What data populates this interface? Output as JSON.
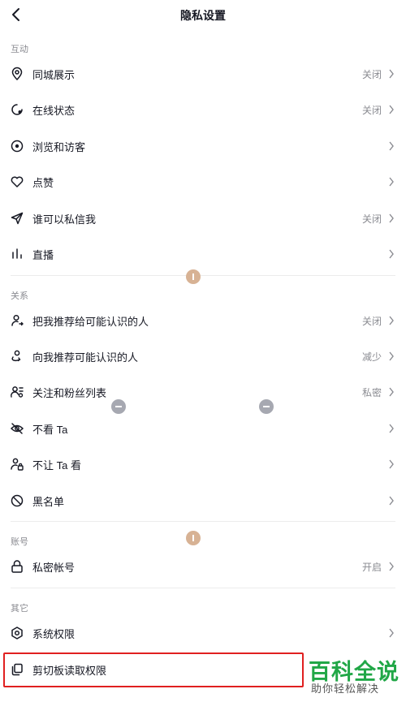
{
  "header": {
    "title": "隐私设置"
  },
  "sections": {
    "interaction": "互动",
    "relation": "关系",
    "account": "账号",
    "other": "其它"
  },
  "rows": {
    "city_display": {
      "label": "同城展示",
      "value": "关闭"
    },
    "online_status": {
      "label": "在线状态",
      "value": "关闭"
    },
    "browse_visitors": {
      "label": "浏览和访客",
      "value": ""
    },
    "likes": {
      "label": "点赞",
      "value": ""
    },
    "who_can_message": {
      "label": "谁可以私信我",
      "value": "关闭"
    },
    "live": {
      "label": "直播",
      "value": ""
    },
    "recommend_me": {
      "label": "把我推荐给可能认识的人",
      "value": "关闭"
    },
    "recommend_to_me": {
      "label": "向我推荐可能认识的人",
      "value": "减少"
    },
    "follow_fans": {
      "label": "关注和粉丝列表",
      "value": "私密"
    },
    "not_see": {
      "label": "不看 Ta",
      "value": ""
    },
    "not_let_see": {
      "label": "不让 Ta 看",
      "value": ""
    },
    "blacklist": {
      "label": "黑名单",
      "value": ""
    },
    "private_account": {
      "label": "私密帐号",
      "value": "开启"
    },
    "system_permission": {
      "label": "系统权限",
      "value": ""
    },
    "clipboard": {
      "label": "剪切板读取权限",
      "value": ""
    }
  },
  "watermark": {
    "main": "百科全说",
    "sub": "助你轻松解决"
  },
  "colors": {
    "highlight": "#e02020",
    "watermark_green": "#21a747"
  }
}
